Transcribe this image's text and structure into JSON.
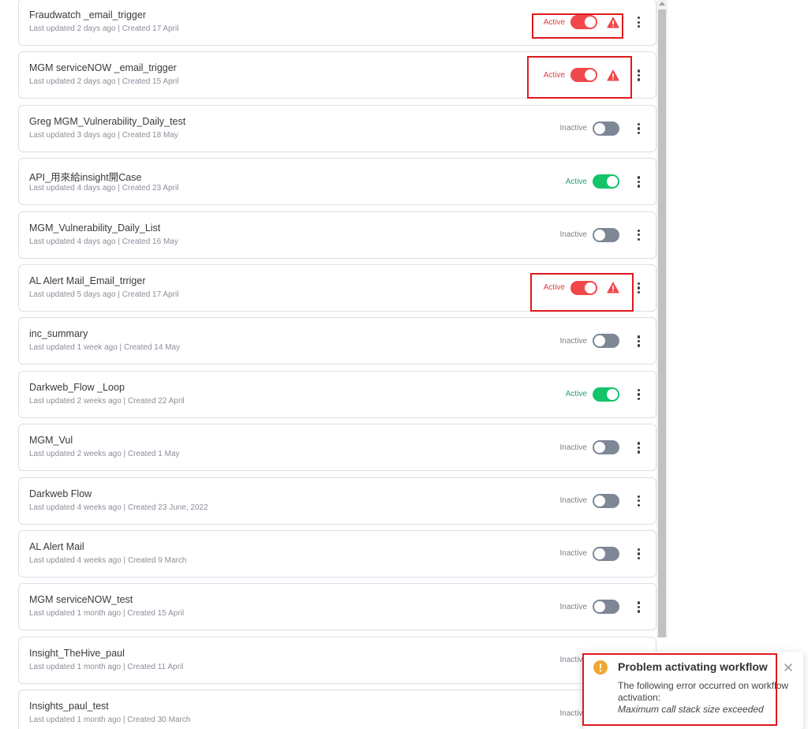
{
  "workflows": [
    {
      "name": "Fraudwatch _email_trigger",
      "last_updated": "Last updated 2 days ago",
      "created": "Created 17 April",
      "status": "Active",
      "state": "error"
    },
    {
      "name": "MGM serviceNOW _email_trigger",
      "last_updated": "Last updated 2 days ago",
      "created": "Created 15 April",
      "status": "Active",
      "state": "error"
    },
    {
      "name": "Greg MGM_Vulnerability_Daily_test",
      "last_updated": "Last updated 3 days ago",
      "created": "Created 18 May",
      "status": "Inactive",
      "state": "off"
    },
    {
      "name": "API_用來給insight開Case",
      "last_updated": "Last updated 4 days ago",
      "created": "Created 23 April",
      "status": "Active",
      "state": "on"
    },
    {
      "name": "MGM_Vulnerability_Daily_List",
      "last_updated": "Last updated 4 days ago",
      "created": "Created 16 May",
      "status": "Inactive",
      "state": "off"
    },
    {
      "name": "AL Alert Mail_Email_trriger",
      "last_updated": "Last updated 5 days ago",
      "created": "Created 17 April",
      "status": "Active",
      "state": "error"
    },
    {
      "name": "inc_summary",
      "last_updated": "Last updated 1 week ago",
      "created": "Created 14 May",
      "status": "Inactive",
      "state": "off"
    },
    {
      "name": "Darkweb_Flow _Loop",
      "last_updated": "Last updated 2 weeks ago",
      "created": "Created 22 April",
      "status": "Active",
      "state": "on"
    },
    {
      "name": "MGM_Vul",
      "last_updated": "Last updated 2 weeks ago",
      "created": "Created 1 May",
      "status": "Inactive",
      "state": "off"
    },
    {
      "name": "Darkweb Flow",
      "last_updated": "Last updated 4 weeks ago",
      "created": "Created 23 June, 2022",
      "status": "Inactive",
      "state": "off"
    },
    {
      "name": "AL Alert Mail",
      "last_updated": "Last updated 4 weeks ago",
      "created": "Created 9 March",
      "status": "Inactive",
      "state": "off"
    },
    {
      "name": "MGM serviceNOW_test",
      "last_updated": "Last updated 1 month ago",
      "created": "Created 15 April",
      "status": "Inactive",
      "state": "off"
    },
    {
      "name": "Insight_TheHive_paul",
      "last_updated": "Last updated 1 month ago",
      "created": "Created 11 April",
      "status": "Inactive",
      "state": "off"
    },
    {
      "name": "Insights_paul_test",
      "last_updated": "Last updated 1 month ago",
      "created": "Created 30 March",
      "status": "Inactive",
      "state": "off"
    }
  ],
  "separator": "|",
  "toast": {
    "title": "Problem activating workflow",
    "message": "The following error occurred on workflow activation:",
    "error": "Maximum call stack size exceeded",
    "icon": "warning-circle-icon",
    "close_icon": "close-icon"
  },
  "icons": {
    "error": "warning-triangle-icon",
    "menu": "more-vertical-icon"
  },
  "colors": {
    "active_green": "#14c46b",
    "error_red": "#f1484c",
    "inactive_gray": "#7d8796",
    "highlight_red": "#e0191c",
    "toast_warning": "#f0a733"
  }
}
